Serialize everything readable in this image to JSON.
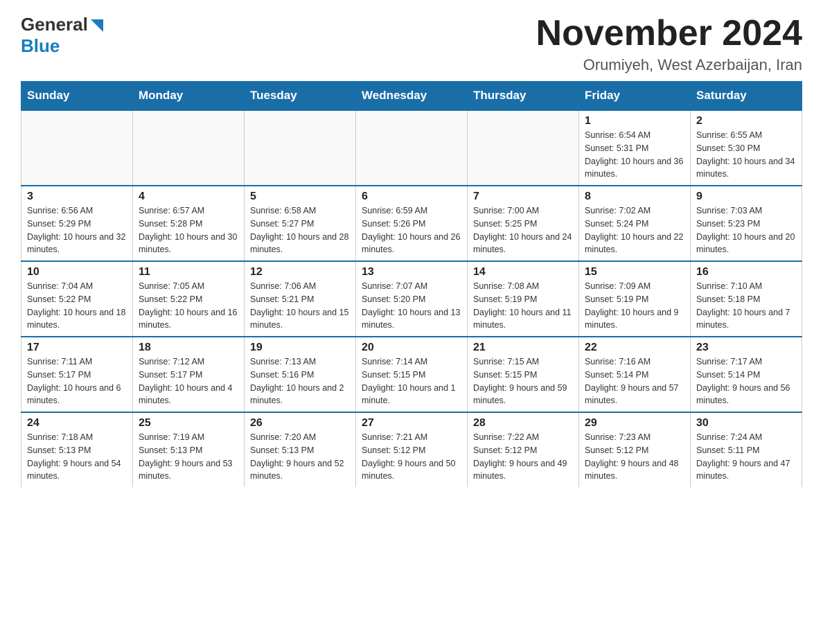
{
  "logo": {
    "general": "General",
    "blue": "Blue"
  },
  "title": "November 2024",
  "location": "Orumiyeh, West Azerbaijan, Iran",
  "weekdays": [
    "Sunday",
    "Monday",
    "Tuesday",
    "Wednesday",
    "Thursday",
    "Friday",
    "Saturday"
  ],
  "weeks": [
    [
      {
        "day": "",
        "info": ""
      },
      {
        "day": "",
        "info": ""
      },
      {
        "day": "",
        "info": ""
      },
      {
        "day": "",
        "info": ""
      },
      {
        "day": "",
        "info": ""
      },
      {
        "day": "1",
        "info": "Sunrise: 6:54 AM\nSunset: 5:31 PM\nDaylight: 10 hours and 36 minutes."
      },
      {
        "day": "2",
        "info": "Sunrise: 6:55 AM\nSunset: 5:30 PM\nDaylight: 10 hours and 34 minutes."
      }
    ],
    [
      {
        "day": "3",
        "info": "Sunrise: 6:56 AM\nSunset: 5:29 PM\nDaylight: 10 hours and 32 minutes."
      },
      {
        "day": "4",
        "info": "Sunrise: 6:57 AM\nSunset: 5:28 PM\nDaylight: 10 hours and 30 minutes."
      },
      {
        "day": "5",
        "info": "Sunrise: 6:58 AM\nSunset: 5:27 PM\nDaylight: 10 hours and 28 minutes."
      },
      {
        "day": "6",
        "info": "Sunrise: 6:59 AM\nSunset: 5:26 PM\nDaylight: 10 hours and 26 minutes."
      },
      {
        "day": "7",
        "info": "Sunrise: 7:00 AM\nSunset: 5:25 PM\nDaylight: 10 hours and 24 minutes."
      },
      {
        "day": "8",
        "info": "Sunrise: 7:02 AM\nSunset: 5:24 PM\nDaylight: 10 hours and 22 minutes."
      },
      {
        "day": "9",
        "info": "Sunrise: 7:03 AM\nSunset: 5:23 PM\nDaylight: 10 hours and 20 minutes."
      }
    ],
    [
      {
        "day": "10",
        "info": "Sunrise: 7:04 AM\nSunset: 5:22 PM\nDaylight: 10 hours and 18 minutes."
      },
      {
        "day": "11",
        "info": "Sunrise: 7:05 AM\nSunset: 5:22 PM\nDaylight: 10 hours and 16 minutes."
      },
      {
        "day": "12",
        "info": "Sunrise: 7:06 AM\nSunset: 5:21 PM\nDaylight: 10 hours and 15 minutes."
      },
      {
        "day": "13",
        "info": "Sunrise: 7:07 AM\nSunset: 5:20 PM\nDaylight: 10 hours and 13 minutes."
      },
      {
        "day": "14",
        "info": "Sunrise: 7:08 AM\nSunset: 5:19 PM\nDaylight: 10 hours and 11 minutes."
      },
      {
        "day": "15",
        "info": "Sunrise: 7:09 AM\nSunset: 5:19 PM\nDaylight: 10 hours and 9 minutes."
      },
      {
        "day": "16",
        "info": "Sunrise: 7:10 AM\nSunset: 5:18 PM\nDaylight: 10 hours and 7 minutes."
      }
    ],
    [
      {
        "day": "17",
        "info": "Sunrise: 7:11 AM\nSunset: 5:17 PM\nDaylight: 10 hours and 6 minutes."
      },
      {
        "day": "18",
        "info": "Sunrise: 7:12 AM\nSunset: 5:17 PM\nDaylight: 10 hours and 4 minutes."
      },
      {
        "day": "19",
        "info": "Sunrise: 7:13 AM\nSunset: 5:16 PM\nDaylight: 10 hours and 2 minutes."
      },
      {
        "day": "20",
        "info": "Sunrise: 7:14 AM\nSunset: 5:15 PM\nDaylight: 10 hours and 1 minute."
      },
      {
        "day": "21",
        "info": "Sunrise: 7:15 AM\nSunset: 5:15 PM\nDaylight: 9 hours and 59 minutes."
      },
      {
        "day": "22",
        "info": "Sunrise: 7:16 AM\nSunset: 5:14 PM\nDaylight: 9 hours and 57 minutes."
      },
      {
        "day": "23",
        "info": "Sunrise: 7:17 AM\nSunset: 5:14 PM\nDaylight: 9 hours and 56 minutes."
      }
    ],
    [
      {
        "day": "24",
        "info": "Sunrise: 7:18 AM\nSunset: 5:13 PM\nDaylight: 9 hours and 54 minutes."
      },
      {
        "day": "25",
        "info": "Sunrise: 7:19 AM\nSunset: 5:13 PM\nDaylight: 9 hours and 53 minutes."
      },
      {
        "day": "26",
        "info": "Sunrise: 7:20 AM\nSunset: 5:13 PM\nDaylight: 9 hours and 52 minutes."
      },
      {
        "day": "27",
        "info": "Sunrise: 7:21 AM\nSunset: 5:12 PM\nDaylight: 9 hours and 50 minutes."
      },
      {
        "day": "28",
        "info": "Sunrise: 7:22 AM\nSunset: 5:12 PM\nDaylight: 9 hours and 49 minutes."
      },
      {
        "day": "29",
        "info": "Sunrise: 7:23 AM\nSunset: 5:12 PM\nDaylight: 9 hours and 48 minutes."
      },
      {
        "day": "30",
        "info": "Sunrise: 7:24 AM\nSunset: 5:11 PM\nDaylight: 9 hours and 47 minutes."
      }
    ]
  ]
}
